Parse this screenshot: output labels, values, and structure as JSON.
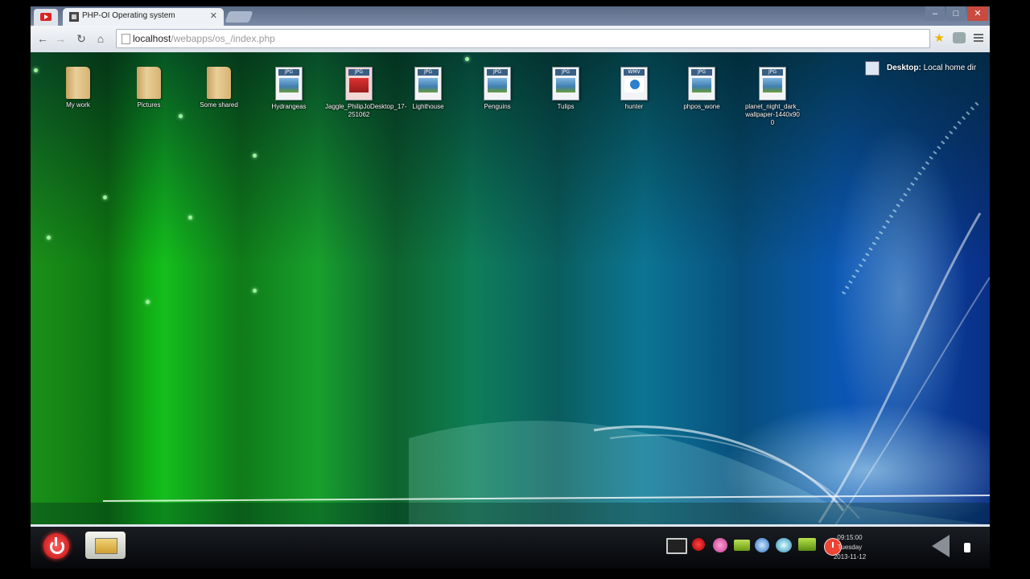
{
  "browser": {
    "tabs": [
      {
        "label": "",
        "icon": "youtube-icon"
      },
      {
        "label": "PHP-OI Operating system",
        "icon": "php-favicon",
        "active": true
      }
    ],
    "url_host": "localhost",
    "url_path": "/webapps/os_/index.php",
    "window_controls": {
      "minimize": "–",
      "maximize": "□",
      "close": "✕"
    }
  },
  "desktop": {
    "icons": [
      {
        "label": "My work",
        "type": "folder"
      },
      {
        "label": "Pictures",
        "type": "folder"
      },
      {
        "label": "Some shared",
        "type": "folder"
      },
      {
        "label": "Hydrangeas",
        "type": "jpg"
      },
      {
        "label": "Jaggle_PhilipJoDesktop_17-251062",
        "type": "jpg"
      },
      {
        "label": "Lighthouse",
        "type": "jpg"
      },
      {
        "label": "Penguins",
        "type": "jpg"
      },
      {
        "label": "Tulips",
        "type": "jpg"
      },
      {
        "label": "hunter",
        "type": "video"
      },
      {
        "label": "phpos_wone",
        "type": "jpg"
      },
      {
        "label": "planet_night_dark_wallpaper-1440x900",
        "type": "jpg"
      }
    ],
    "location_prefix": "Desktop:",
    "location_value": "Local home dir"
  },
  "taskbar": {
    "tray_icons": [
      "monitor-icon",
      "apple-icon",
      "chat-icon",
      "battery-icon",
      "globe-icon",
      "media-icon",
      "screen-icon",
      "clock-icon"
    ],
    "clock_time": "09:15:00",
    "clock_day": "Tuesday",
    "clock_date": "2013-11-12"
  },
  "colors": {
    "wallpaper_green": "#13c21a",
    "wallpaper_blue": "#0a2f86",
    "power_red": "#c30f0f"
  }
}
